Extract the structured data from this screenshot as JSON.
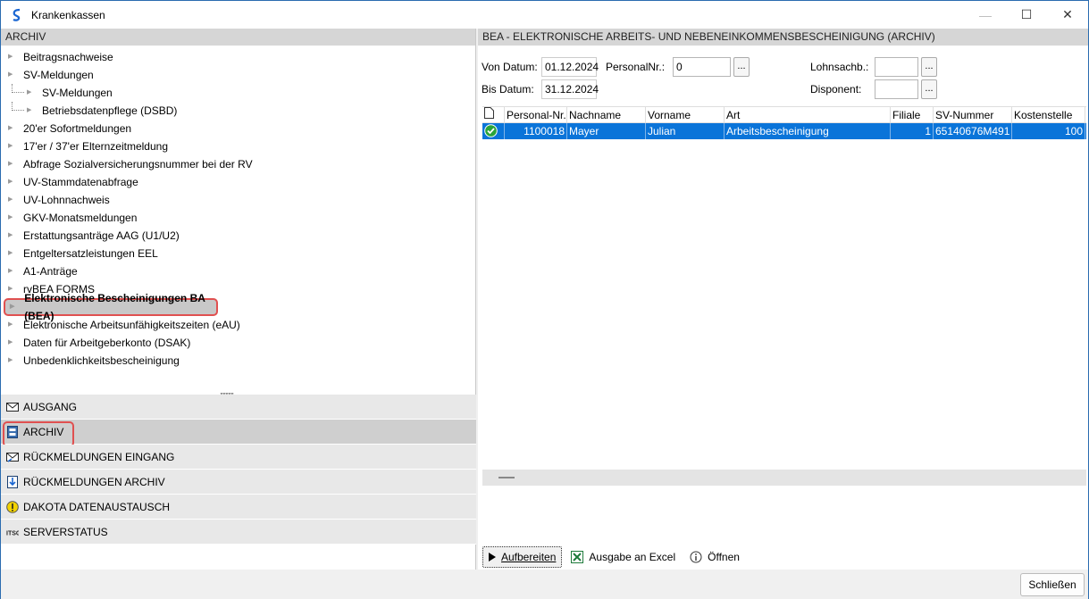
{
  "window": {
    "title": "Krankenkassen",
    "minimize": "—",
    "maximize": "☐",
    "close": "✕"
  },
  "left": {
    "header": "ARCHIV",
    "tree": [
      {
        "label": "Beitragsnachweise"
      },
      {
        "label": "SV-Meldungen"
      },
      {
        "label": "SV-Meldungen",
        "child": true
      },
      {
        "label": "Betriebsdatenpflege (DSBD)",
        "child": true
      },
      {
        "label": "20'er Sofortmeldungen"
      },
      {
        "label": "17'er / 37'er Elternzeitmeldung"
      },
      {
        "label": "Abfrage Sozialversicherungsnummer bei der RV"
      },
      {
        "label": "UV-Stammdatenabfrage"
      },
      {
        "label": "UV-Lohnnachweis"
      },
      {
        "label": "GKV-Monatsmeldungen"
      },
      {
        "label": "Erstattungsanträge AAG (U1/U2)"
      },
      {
        "label": "Entgeltersatzleistungen EEL"
      },
      {
        "label": "A1-Anträge"
      },
      {
        "label": "rvBEA FORMS"
      },
      {
        "label": "Elektronische Bescheinigungen BA (BEA)",
        "selected": true
      },
      {
        "label": "Elektronische Arbeitsunfähigkeitszeiten (eAU)"
      },
      {
        "label": "Daten für Arbeitgeberkonto (DSAK)"
      },
      {
        "label": "Unbedenklichkeitsbescheinigung"
      }
    ],
    "nav": [
      {
        "label": "AUSGANG",
        "icon": "envelope-out-icon"
      },
      {
        "label": "ARCHIV",
        "icon": "archive-icon",
        "active": true
      },
      {
        "label": "RÜCKMELDUNGEN EINGANG",
        "icon": "envelope-in-icon"
      },
      {
        "label": "RÜCKMELDUNGEN ARCHIV",
        "icon": "archive-return-icon"
      },
      {
        "label": "DAKOTA DATENAUSTAUSCH",
        "icon": "warning-icon"
      },
      {
        "label": "SERVERSTATUS",
        "icon": "itsg-icon"
      }
    ]
  },
  "right": {
    "header": "BEA - ELEKTRONISCHE ARBEITS- UND NEBENEINKOMMENSBESCHEINIGUNG (ARCHIV)",
    "form": {
      "von_label": "Von Datum:",
      "von_value": "01.12.2024",
      "bis_label": "Bis Datum:",
      "bis_value": "31.12.2024",
      "personal_label": "PersonalNr.:",
      "personal_value": "0",
      "lohn_label": "Lohnsachb.:",
      "lohn_value": "",
      "disp_label": "Disponent:",
      "disp_value": "",
      "dots": "..."
    },
    "grid": {
      "columns": [
        "",
        "Personal-Nr.",
        "Nachname",
        "Vorname",
        "Art",
        "Filiale",
        "SV-Nummer",
        "Kostenstelle"
      ],
      "rows": [
        [
          "",
          "1100018",
          "Mayer",
          "Julian",
          "Arbeitsbescheinigung",
          "1",
          "65140676M491",
          "100"
        ]
      ]
    },
    "actions": {
      "aufbereiten": "Aufbereiten",
      "excel": "Ausgabe an Excel",
      "oeffnen": "Öffnen"
    }
  },
  "footer": {
    "close": "Schließen"
  }
}
